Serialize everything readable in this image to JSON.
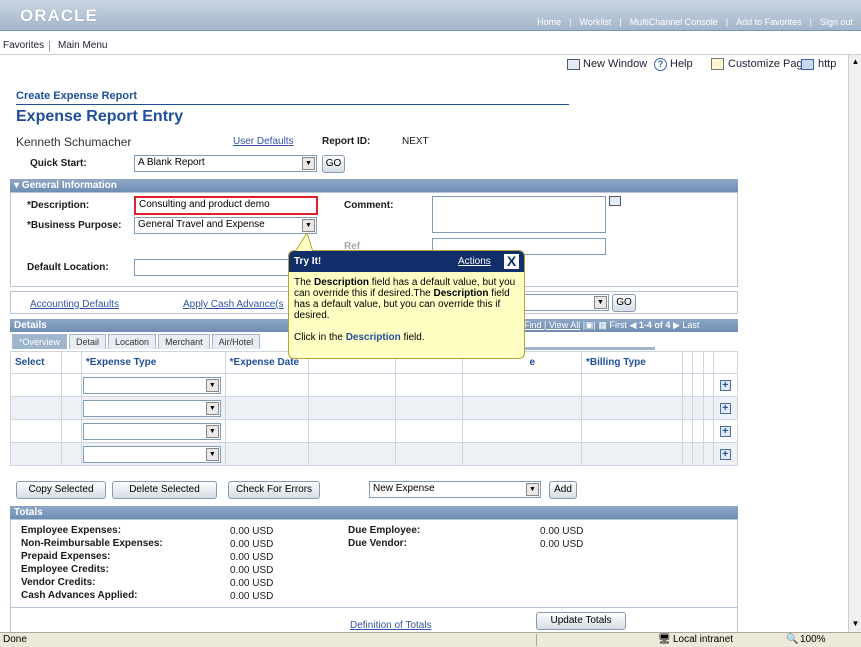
{
  "oracle_logo": "ORACLE",
  "top_links": [
    "Home",
    "Worklist",
    "MultiChannel Console",
    "Add to Favorites",
    "Sign out"
  ],
  "menu": {
    "favorites": "Favorites",
    "main_menu": "Main Menu"
  },
  "toolbar": {
    "new_window": "New Window",
    "help": "Help",
    "customize_page": "Customize Page",
    "http": "http"
  },
  "breadcrumb": "Create Expense Report",
  "page_title": "Expense Report Entry",
  "user_name": "Kenneth Schumacher",
  "user_defaults": "User Defaults",
  "report_id_label": "Report ID:",
  "report_id_value": "NEXT",
  "quick_start_label": "Quick Start:",
  "quick_start_value": "A Blank Report",
  "go_label": "GO",
  "general": {
    "header": "General Information",
    "description_label": "*Description:",
    "description_value": "Consulting and product demo",
    "business_purpose_label": "*Business Purpose:",
    "business_purpose_value": "General Travel and Expense",
    "comment_label": "Comment:",
    "default_location_label": "Default Location:",
    "ref_label": "Ref"
  },
  "accounting_defaults": "Accounting Defaults",
  "apply_cash_advance": "Apply Cash Advance(s",
  "details": {
    "header": "Details",
    "nav": "Find | View All",
    "first": "First",
    "range": "1-4 of 4",
    "last": "Last",
    "tabs": [
      "*Overview",
      "Detail",
      "Location",
      "Merchant",
      "Air/Hotel"
    ],
    "col_select": "Select",
    "col_expense_type": "*Expense Type",
    "col_expense_date": "*Expense Date",
    "col_type_partial": "e",
    "col_billing_type": "*Billing Type"
  },
  "buttons": {
    "copy_selected": "Copy Selected",
    "delete_selected": "Delete Selected",
    "check_errors": "Check For Errors",
    "new_expense": "New Expense",
    "add": "Add",
    "update_totals": "Update Totals"
  },
  "totals": {
    "header": "Totals",
    "left": [
      {
        "label": "Employee Expenses:",
        "value": "0.00",
        "cur": "USD"
      },
      {
        "label": "Non-Reimbursable Expenses:",
        "value": "0.00",
        "cur": "USD"
      },
      {
        "label": "Prepaid Expenses:",
        "value": "0.00",
        "cur": "USD"
      },
      {
        "label": "Employee Credits:",
        "value": "0.00",
        "cur": "USD"
      },
      {
        "label": "Vendor Credits:",
        "value": "0.00",
        "cur": "USD"
      },
      {
        "label": "Cash Advances Applied:",
        "value": "0.00",
        "cur": "USD"
      }
    ],
    "right": [
      {
        "label": "Due Employee:",
        "value": "0.00",
        "cur": "USD"
      },
      {
        "label": "Due Vendor:",
        "value": "0.00",
        "cur": "USD"
      }
    ],
    "definition": "Definition of Totals"
  },
  "callout": {
    "title": "Try It!",
    "actions": "Actions",
    "close": "X",
    "line1a": "The ",
    "line1b": "Description",
    "line1c": " field has a default value, but you can override this if desired.The ",
    "line1d": "Description",
    "line1e": " field has a default value, but you can override this if desired.",
    "line2a": "Click in the ",
    "line2b": "Description",
    "line2c": " field."
  },
  "status": {
    "done": "Done",
    "zone": "Local intranet",
    "zoom": "100%"
  }
}
